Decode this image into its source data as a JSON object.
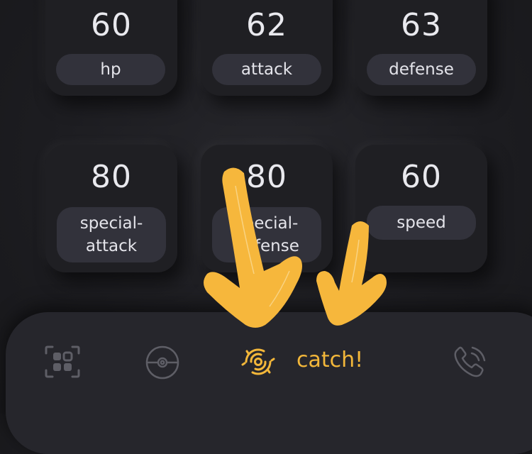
{
  "stats": [
    {
      "value": "60",
      "label": "hp"
    },
    {
      "value": "62",
      "label": "attack"
    },
    {
      "value": "63",
      "label": "defense"
    },
    {
      "value": "80",
      "label": "special-\nattack"
    },
    {
      "value": "80",
      "label": "special-\ndefense"
    },
    {
      "value": "60",
      "label": "speed"
    }
  ],
  "nav": {
    "items": [
      {
        "icon": "qr-scan-icon",
        "label": ""
      },
      {
        "icon": "pokeball-icon",
        "label": ""
      },
      {
        "icon": "catch-icon",
        "label": "catch!"
      },
      {
        "icon": "phone-call-icon",
        "label": ""
      }
    ],
    "active_color": "#f3b73a",
    "inactive_color": "#5e5e66"
  },
  "overlay": {
    "icon": "yellow-arrows-icon",
    "color": "#f6b73c"
  }
}
